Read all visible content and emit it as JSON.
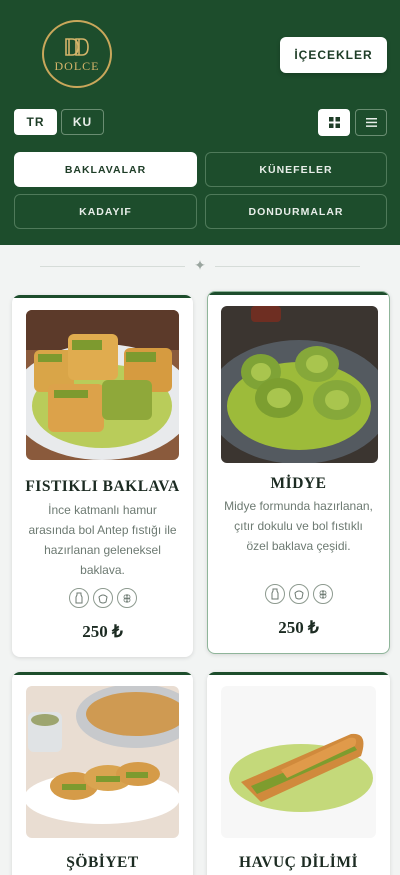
{
  "brand": {
    "name": "DOLCE"
  },
  "header": {
    "drinks_label": "İÇECEKLER"
  },
  "languages": [
    {
      "code": "TR",
      "active": true
    },
    {
      "code": "KU",
      "active": false
    }
  ],
  "view_modes": [
    {
      "icon": "grid-view-icon",
      "active": true
    },
    {
      "icon": "list-view-icon",
      "active": false
    }
  ],
  "categories": [
    {
      "label": "BAKLAVALAR",
      "active": true
    },
    {
      "label": "KÜNEFELER",
      "active": false
    },
    {
      "label": "KADAYIF",
      "active": false
    },
    {
      "label": "DONDURMALAR",
      "active": false
    }
  ],
  "products": [
    {
      "title": "FISTIKLI BAKLAVA",
      "description": "İnce katmanlı hamur arasında bol Antep fıstığı ile hazırlanan geleneksel baklava.",
      "price": "250 ₺",
      "icons": [
        "milk-icon",
        "nut-icon",
        "wheat-icon"
      ]
    },
    {
      "title": "MİDYE",
      "description": "Midye formunda hazırlanan, çıtır dokulu ve bol fıstıklı özel baklava çeşidi.",
      "price": "250 ₺",
      "icons": [
        "milk-icon",
        "nut-icon",
        "wheat-icon"
      ]
    },
    {
      "title": "ŞÖBİYET",
      "description": "",
      "price": "",
      "icons": []
    },
    {
      "title": "HAVUÇ DİLİMİ",
      "description": "",
      "price": "",
      "icons": []
    }
  ],
  "colors": {
    "header_bg": "#1d4d2c",
    "gold": "#c9a75b",
    "page_bg": "#f2f4f3"
  }
}
